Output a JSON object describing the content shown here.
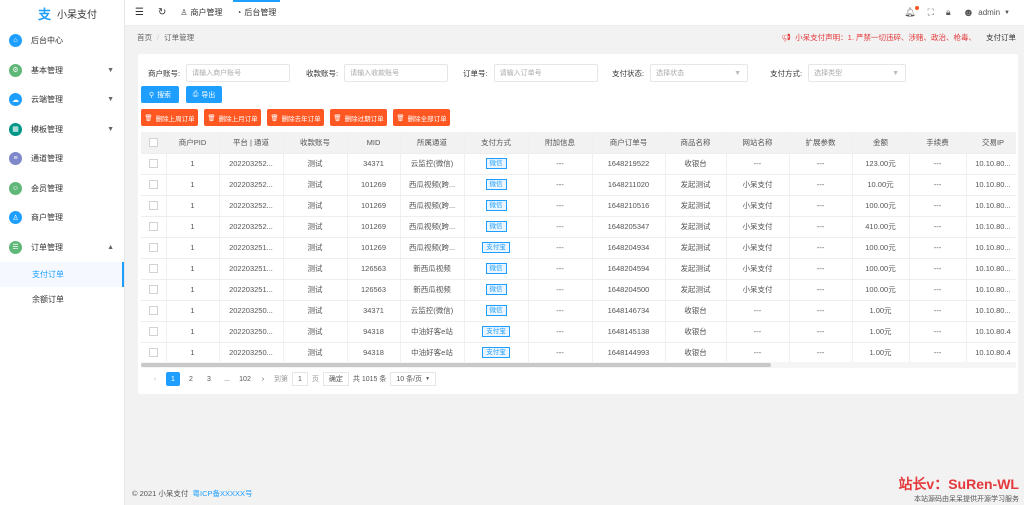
{
  "app": {
    "title": "小呆支付",
    "logo_icon": "logo-icon"
  },
  "sidebar": {
    "items": [
      {
        "label": "后台中心",
        "icon": "home-icon",
        "color": "#1e9fff",
        "arrow": ""
      },
      {
        "label": "基本管理",
        "icon": "settings-icon",
        "color": "#5fb878",
        "arrow": "▼"
      },
      {
        "label": "云端管理",
        "icon": "cloud-icon",
        "color": "#1e9fff",
        "arrow": "▼"
      },
      {
        "label": "模板管理",
        "icon": "template-icon",
        "color": "#009688",
        "arrow": "▼"
      },
      {
        "label": "通道管理",
        "icon": "channel-icon",
        "color": "#7e88ca",
        "arrow": ""
      },
      {
        "label": "会员管理",
        "icon": "member-icon",
        "color": "#5fb878",
        "arrow": ""
      },
      {
        "label": "商户管理",
        "icon": "merchant-icon",
        "color": "#1e9fff",
        "arrow": ""
      },
      {
        "label": "订单管理",
        "icon": "order-icon",
        "color": "#5fb878",
        "arrow": "▲"
      }
    ],
    "subitems": [
      "支付订单",
      "余额订单"
    ]
  },
  "header": {
    "nav": [
      "商户管理",
      "后台管理"
    ],
    "user": "admin"
  },
  "crumb": {
    "home": "首页",
    "sep": "/",
    "current": "订单管理",
    "notice": "小呆支付声明：1. 严禁一切违碎、涉赌、政治、枪毒、",
    "paylink": "支付订单"
  },
  "filters": [
    {
      "label": "商户账号:",
      "placeholder": "请输入商户账号"
    },
    {
      "label": "收款账号:",
      "placeholder": "请输入收款账号"
    },
    {
      "label": "订单号:",
      "placeholder": "请输入订单号"
    },
    {
      "label": "支付状态:",
      "placeholder": "选择状态"
    },
    {
      "label": "支付方式:",
      "placeholder": "选择类型"
    }
  ],
  "buttons": {
    "search": "搜索",
    "export": "导出",
    "delete": [
      "删除上周订单",
      "删除上月订单",
      "删除去年订单",
      "删除过期订单",
      "删除全部订单"
    ]
  },
  "table": {
    "headers": [
      "",
      "商户PID",
      "平台 | 通道",
      "收款账号",
      "MID",
      "所属通道",
      "支付方式",
      "附加信息",
      "商户订单号",
      "商品名称",
      "网站名称",
      "扩展参数",
      "金额",
      "手续费",
      "交易IP"
    ],
    "rows": [
      [
        "1",
        "202203252...",
        "测试",
        "34371",
        "云监控(微信)",
        "微信",
        "---",
        "1648219522",
        "收银台",
        "---",
        "---",
        "123.00元",
        "---",
        "10.10.80..."
      ],
      [
        "1",
        "202203252...",
        "测试",
        "101269",
        "西瓜视频(跨...",
        "微信",
        "---",
        "1648211020",
        "发起测试",
        "小呆支付",
        "---",
        "10.00元",
        "---",
        "10.10.80..."
      ],
      [
        "1",
        "202203252...",
        "测试",
        "101269",
        "西瓜视频(跨...",
        "微信",
        "---",
        "1648210516",
        "发起测试",
        "小呆支付",
        "---",
        "100.00元",
        "---",
        "10.10.80..."
      ],
      [
        "1",
        "202203252...",
        "测试",
        "101269",
        "西瓜视频(跨...",
        "微信",
        "---",
        "1648205347",
        "发起测试",
        "小呆支付",
        "---",
        "410.00元",
        "---",
        "10.10.80..."
      ],
      [
        "1",
        "202203251...",
        "测试",
        "101269",
        "西瓜视频(跨...",
        "支付宝",
        "---",
        "1648204934",
        "发起测试",
        "小呆支付",
        "---",
        "100.00元",
        "---",
        "10.10.80..."
      ],
      [
        "1",
        "202203251...",
        "测试",
        "126563",
        "新西瓜视频",
        "微信",
        "---",
        "1648204594",
        "发起测试",
        "小呆支付",
        "---",
        "100.00元",
        "---",
        "10.10.80..."
      ],
      [
        "1",
        "202203251...",
        "测试",
        "126563",
        "新西瓜视频",
        "微信",
        "---",
        "1648204500",
        "发起测试",
        "小呆支付",
        "---",
        "100.00元",
        "---",
        "10.10.80..."
      ],
      [
        "1",
        "202203250...",
        "测试",
        "34371",
        "云监控(微信)",
        "微信",
        "---",
        "1648146734",
        "收银台",
        "---",
        "---",
        "1.00元",
        "---",
        "10.10.80..."
      ],
      [
        "1",
        "202203250...",
        "测试",
        "94318",
        "中油好客e站",
        "支付宝",
        "---",
        "1648145138",
        "收银台",
        "---",
        "---",
        "1.00元",
        "---",
        "10.10.80.4"
      ],
      [
        "1",
        "202203250...",
        "测试",
        "94318",
        "中油好客e站",
        "支付宝",
        "---",
        "1648144993",
        "收银台",
        "---",
        "---",
        "1.00元",
        "---",
        "10.10.80.4"
      ]
    ]
  },
  "pager": {
    "prev": "‹",
    "pages": [
      "1",
      "2",
      "3",
      "...",
      "102"
    ],
    "next": "›",
    "goto": "到第",
    "page_value": "1",
    "page_unit": "页",
    "confirm": "确定",
    "total": "共 1015 条",
    "size": "10 条/页"
  },
  "footer": {
    "copyright": "© 2021 小呆支付",
    "icp": "粤ICP备XXXXX号"
  },
  "watermark": {
    "line1": "站长v：SuRen-WL",
    "line2": "本站源码由呆呆提供开源学习服务"
  }
}
